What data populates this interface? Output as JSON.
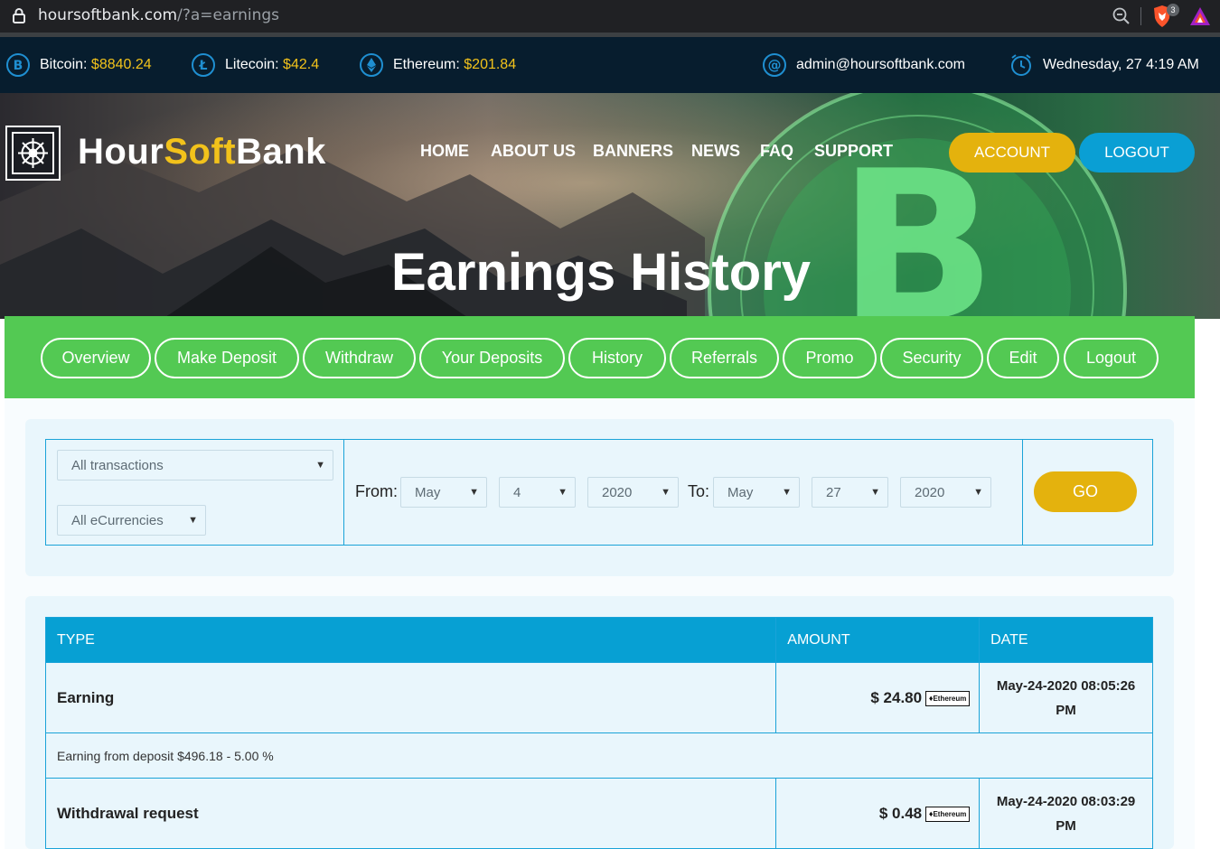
{
  "browser": {
    "url_host": "hoursoftbank.com",
    "url_path": "/?a=earnings",
    "extension_badge": "3"
  },
  "ticker": {
    "bitcoin_label": "Bitcoin:",
    "bitcoin_value": "$8840.24",
    "litecoin_label": "Litecoin:",
    "litecoin_value": "$42.4",
    "ethereum_label": "Ethereum:",
    "ethereum_value": "$201.84",
    "email": "admin@hoursoftbank.com",
    "datetime": "Wednesday, 27 4:19 AM"
  },
  "header": {
    "logo_part1": "Hour",
    "logo_part2": "Soft",
    "logo_part3": "Bank",
    "nav": [
      "HOME",
      "ABOUT US",
      "BANNERS",
      "NEWS",
      "FAQ",
      "SUPPORT"
    ],
    "account_label": "ACCOUNT",
    "logout_label": "LOGOUT",
    "page_title": "Earnings History"
  },
  "tabs": [
    "Overview",
    "Make Deposit",
    "Withdraw",
    "Your Deposits",
    "History",
    "Referrals",
    "Promo",
    "Security",
    "Edit",
    "Logout"
  ],
  "filter": {
    "type_select": "All transactions",
    "currency_select": "All eCurrencies",
    "from_label": "From:",
    "from_month": "May",
    "from_day": "4",
    "from_year": "2020",
    "to_label": "To:",
    "to_month": "May",
    "to_day": "27",
    "to_year": "2020",
    "go_label": "GO"
  },
  "table": {
    "headers": [
      "TYPE",
      "AMOUNT",
      "DATE"
    ],
    "rows": [
      {
        "type": "Earning",
        "amount": "$ 24.80",
        "currency_badge": "Ethereum",
        "date_line1": "May-24-2020 08:05:26",
        "date_line2": "PM",
        "description": "Earning from deposit $496.18 - 5.00 %"
      },
      {
        "type": "Withdrawal request",
        "amount": "$ 0.48",
        "currency_badge": "Ethereum",
        "date_line1": "May-24-2020 08:03:29",
        "date_line2": "PM"
      }
    ]
  },
  "colors": {
    "accent_yellow": "#f2c21b",
    "button_yellow": "#e4b20d",
    "button_blue": "#0a9fd4",
    "tab_green": "#53c953",
    "table_header_blue": "#07a0d3",
    "ticker_bg": "#071d2e"
  }
}
